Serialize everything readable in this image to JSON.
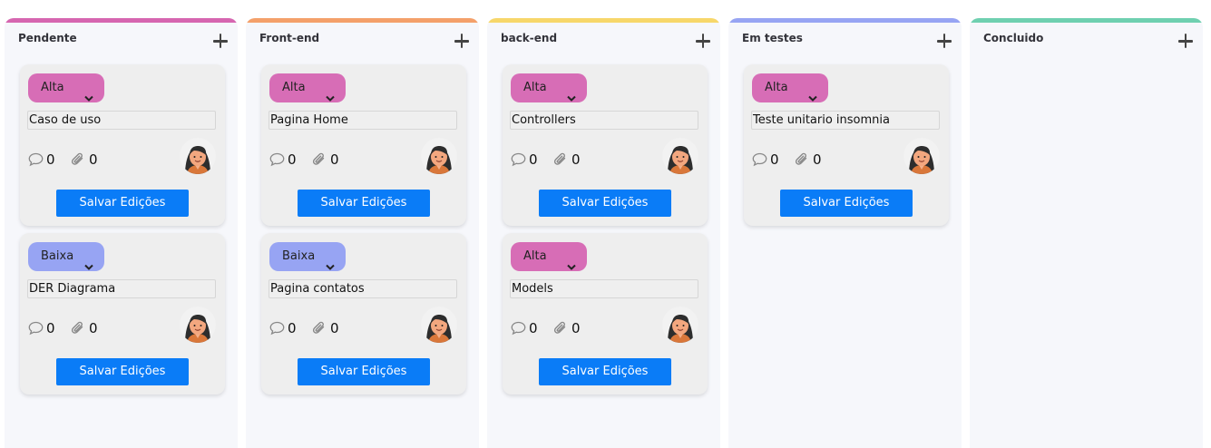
{
  "columns": [
    {
      "title": "Pendente",
      "accent": "#d666b0",
      "cards": [
        {
          "priority": "Alta",
          "priority_color": "#d76db6",
          "title": "Caso de uso",
          "comments": "0",
          "attachments": "0",
          "save_label": "Salvar Edições"
        },
        {
          "priority": "Baixa",
          "priority_color": "#97a4f3",
          "title": "DER Diagrama",
          "comments": "0",
          "attachments": "0",
          "save_label": "Salvar Edições"
        }
      ]
    },
    {
      "title": "Front-end",
      "accent": "#f4a06a",
      "cards": [
        {
          "priority": "Alta",
          "priority_color": "#d76db6",
          "title": "Pagina Home",
          "comments": "0",
          "attachments": "0",
          "save_label": "Salvar Edições"
        },
        {
          "priority": "Baixa",
          "priority_color": "#97a4f3",
          "title": "Pagina contatos",
          "comments": "0",
          "attachments": "0",
          "save_label": "Salvar Edições"
        }
      ]
    },
    {
      "title": "back-end",
      "accent": "#f7d76a",
      "cards": [
        {
          "priority": "Alta",
          "priority_color": "#d76db6",
          "title": "Controllers",
          "comments": "0",
          "attachments": "0",
          "save_label": "Salvar Edições"
        },
        {
          "priority": "Alta",
          "priority_color": "#d76db6",
          "title": "Models",
          "comments": "0",
          "attachments": "0",
          "save_label": "Salvar Edições"
        }
      ]
    },
    {
      "title": "Em testes",
      "accent": "#97a4f3",
      "cards": [
        {
          "priority": "Alta",
          "priority_color": "#d76db6",
          "title": "Teste unitario insomnia",
          "comments": "0",
          "attachments": "0",
          "save_label": "Salvar Edições"
        }
      ]
    },
    {
      "title": "Concluido",
      "accent": "#6fd0b0",
      "cards": []
    }
  ],
  "icons": {
    "add": "plus-icon",
    "priority": "chevron-down-icon",
    "comments": "comment-icon",
    "attachments": "paperclip-icon",
    "avatar": "user-avatar"
  }
}
